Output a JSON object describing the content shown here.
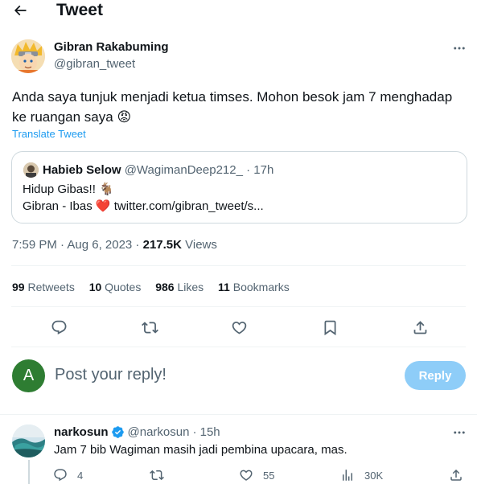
{
  "header": {
    "title": "Tweet",
    "back_icon": "arrow-left-icon"
  },
  "tweet": {
    "author_name": "Gibran Rakabuming",
    "author_handle": "@gibran_tweet",
    "avatar_icon": "avatar-naruto-icon",
    "more_icon": "more-horizontal-icon",
    "text_line1": "Anda saya tunjuk menjadi ketua timses. Mohon besok jam 7 menghadap",
    "text_line2": "ke ruangan saya",
    "emoji": "😡",
    "translate_label": "Translate Tweet",
    "quoted": {
      "author_name": "Habieb Selow",
      "author_handle": "@WagimanDeep212_",
      "time": "· 17h",
      "line1": "Hidup Gibas!! 🐐",
      "line2_prefix": "Gibran - Ibas",
      "heart_emoji": "❤️",
      "line2_link": "twitter.com/gibran_tweet/s..."
    },
    "timestamp": "7:59 PM · Aug 6, 2023 · ",
    "views_count": "217.5K",
    "views_label": " Views",
    "stats": {
      "retweets_count": "99",
      "retweets_label": " Retweets",
      "quotes_count": "10",
      "quotes_label": " Quotes",
      "likes_count": "986",
      "likes_label": " Likes",
      "bookmarks_count": "11",
      "bookmarks_label": " Bookmarks"
    },
    "actions": [
      "reply-icon",
      "retweet-icon",
      "like-icon",
      "bookmark-icon",
      "share-icon"
    ]
  },
  "reply_box": {
    "avatar_letter": "A",
    "placeholder": "Post your reply!",
    "button_label": "Reply",
    "accent": "#1d9bf0",
    "avatar_color": "#2e7d32"
  },
  "reply": {
    "author_name": "narkosun",
    "verified_icon": "verified-badge-icon",
    "author_handle": "@narkosun",
    "time": "· 15h",
    "text": "Jam 7 bib Wagiman masih jadi pembina upacara, mas.",
    "reply_count": "4",
    "likes_count": "55",
    "views_count": "30K"
  }
}
